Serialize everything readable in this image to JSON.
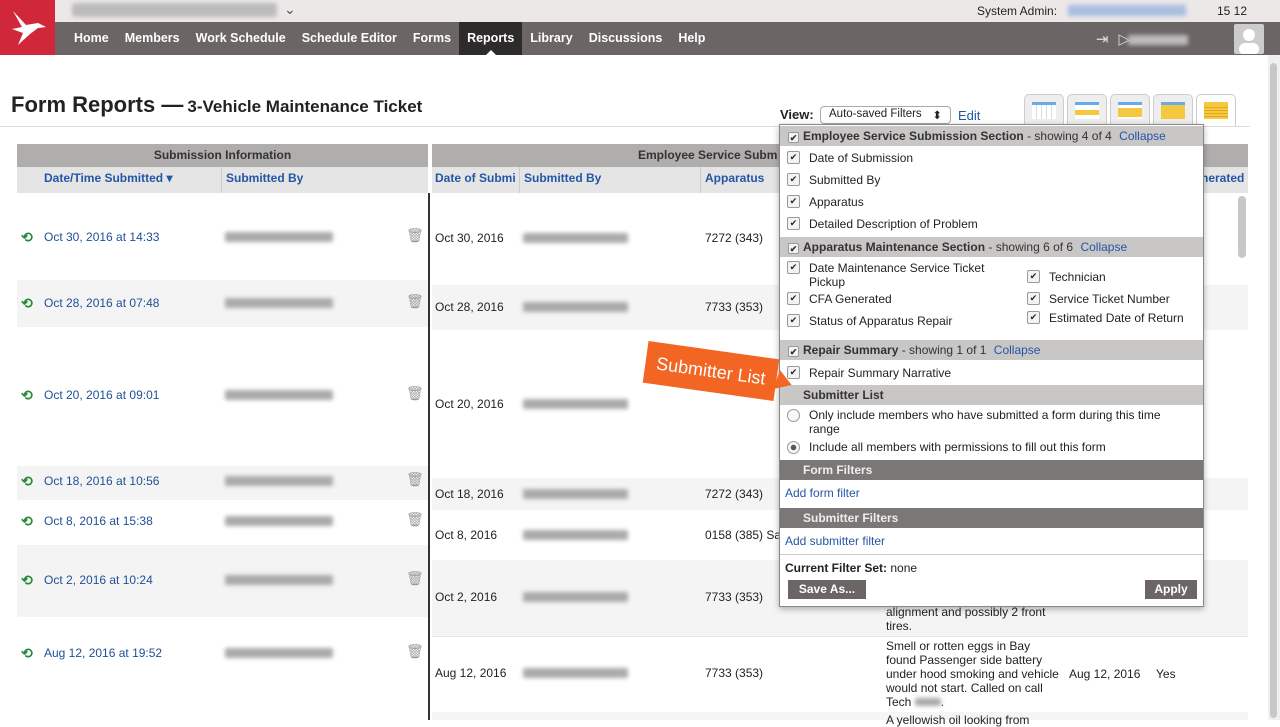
{
  "header": {
    "org_name_blurred": true,
    "system_label": "System Admin:",
    "time": "15 12"
  },
  "nav": {
    "items": [
      "Home",
      "Members",
      "Work Schedule",
      "Schedule Editor",
      "Forms",
      "Reports",
      "Library",
      "Discussions",
      "Help"
    ],
    "active": "Reports"
  },
  "page": {
    "title": "Form Reports —",
    "subtitle": "3-Vehicle Maintenance Ticket"
  },
  "view": {
    "label": "View:",
    "selected": "Auto-saved Filters",
    "edit": "Edit"
  },
  "table": {
    "left_header": "Submission Information",
    "right_header": "Employee Service Subm",
    "left_cols": [
      "Date/Time Submitted ▾",
      "Submitted By"
    ],
    "right_cols": [
      "Date of Submi",
      "Submitted By",
      "Apparatus"
    ],
    "right_last_col": "nerated",
    "rows": [
      {
        "submitted": "Oct 30, 2016 at 14:33",
        "date": "Oct 30, 2016",
        "apparatus": "7272 (343)"
      },
      {
        "submitted": "Oct 28, 2016 at 07:48",
        "date": "Oct 28, 2016",
        "apparatus": "7733 (353)"
      },
      {
        "submitted": "Oct 20, 2016 at 09:01",
        "date": "Oct 20, 2016",
        "apparatus": ""
      },
      {
        "submitted": "Oct 18, 2016 at 10:56",
        "date": "Oct 18, 2016",
        "apparatus": "7272 (343)"
      },
      {
        "submitted": "Oct 8, 2016 at 15:38",
        "date": "Oct 8, 2016",
        "apparatus": "0158 (385) Sa"
      },
      {
        "submitted": "Oct 2, 2016 at 10:24",
        "date": "Oct 2, 2016",
        "apparatus": "7733 (353)"
      },
      {
        "submitted": "Aug 12, 2016 at 19:52",
        "date": "Aug 12, 2016",
        "apparatus": "7733 (353)"
      }
    ],
    "desc_partial": [
      "alignment and possibly 2 front",
      "tires."
    ],
    "desc_aug": [
      "Smell or rotten eggs in Bay",
      "found Passenger side battery",
      "under hood smoking and vehicle",
      "would not start. Called on call",
      "Tech"
    ],
    "aug_date": "Aug 12, 2016",
    "aug_cfa": "Yes",
    "desc_next": "A yellowish oil looking from"
  },
  "popup": {
    "sec1": {
      "title": "Employee Service Submission Section",
      "count": "- showing 4 of 4",
      "link": "Collapse",
      "items": [
        "Date of Submission",
        "Submitted By",
        "Apparatus",
        "Detailed Description of Problem"
      ]
    },
    "sec2": {
      "title": "Apparatus Maintenance Section",
      "count": "- showing 6 of 6",
      "link": "Collapse",
      "items": [
        "Date Maintenance Service Ticket Pickup",
        "Technician",
        "CFA Generated",
        "Service Ticket Number",
        "Status of Apparatus Repair",
        "Estimated Date of Return"
      ]
    },
    "sec3": {
      "title": "Repair Summary",
      "count": "- showing 1 of 1",
      "link": "Collapse",
      "items": [
        "Repair Summary Narrative"
      ]
    },
    "submitter_list": {
      "title": "Submitter List",
      "options": [
        "Only include members who have submitted a form during this time range",
        "Include all members with permissions to fill out this form"
      ],
      "selected": 1
    },
    "form_filters": {
      "title": "Form Filters",
      "link": "Add form filter"
    },
    "submitter_filters": {
      "title": "Submitter Filters",
      "link": "Add submitter filter"
    },
    "current_label": "Current Filter Set:",
    "current_value": "none",
    "save_as": "Save As...",
    "apply": "Apply"
  },
  "callout": "Submitter List",
  "colors": {
    "brand": "#d0283a",
    "nav": "#6b6565",
    "link": "#2456a6",
    "callout": "#f26522"
  }
}
